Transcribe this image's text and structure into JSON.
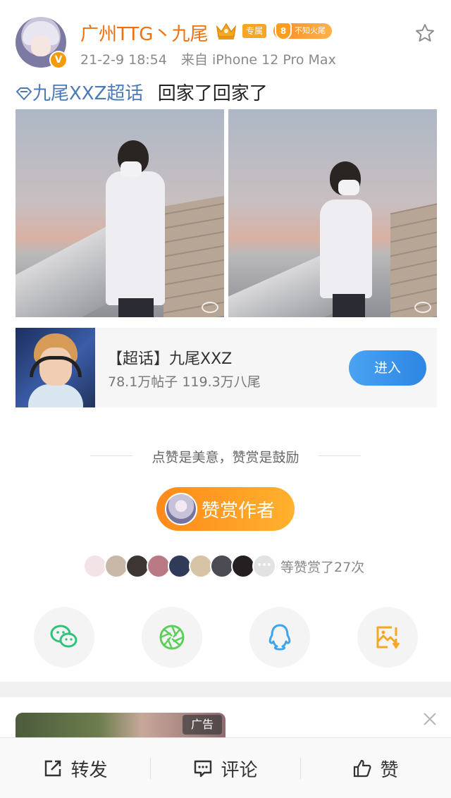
{
  "post": {
    "username": "广州TTG丶九尾",
    "tag_label": "专属",
    "fan_badge": {
      "level": "8",
      "name": "不知火尾"
    },
    "timestamp": "21-2-9 18:54",
    "source": "来自 iPhone 12 Pro Max",
    "topic": "九尾XXZ超话",
    "body": "回家了回家了"
  },
  "supertopic_card": {
    "title": "【超话】九尾XXZ",
    "stats": "78.1万帖子 119.3万八尾",
    "enter_label": "进入"
  },
  "reward": {
    "tip": "点赞是美意，赞赏是鼓励",
    "button_label": "赞赏作者",
    "supporters_text": "等赞赏了27次",
    "more_icon": "more-dots-icon",
    "supporter_colors": [
      "#f4e3e6",
      "#c9b8a8",
      "#3d3532",
      "#b97a86",
      "#2f3b58",
      "#d7c3a5",
      "#4c4a52",
      "#261f22"
    ]
  },
  "share": [
    {
      "name": "wechat",
      "icon": "wechat-icon",
      "color": "#2fc27a"
    },
    {
      "name": "moments",
      "icon": "moments-icon",
      "color": "#5ccf5b"
    },
    {
      "name": "qq",
      "icon": "qq-icon",
      "color": "#3ea4ec"
    },
    {
      "name": "save-image",
      "icon": "save-image-icon",
      "color": "#f5a623"
    }
  ],
  "ad": {
    "label": "广告"
  },
  "bottom_bar": {
    "repost": "转发",
    "comment": "评论",
    "like": "赞"
  },
  "colors": {
    "accent_orange": "#f26f0a",
    "topic_blue": "#4a7bb8",
    "enter_blue": "#3594e9"
  }
}
